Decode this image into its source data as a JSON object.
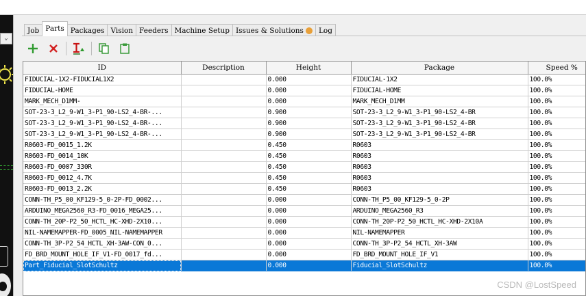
{
  "tabs": [
    {
      "label": "Job"
    },
    {
      "label": "Parts"
    },
    {
      "label": "Packages"
    },
    {
      "label": "Vision"
    },
    {
      "label": "Feeders"
    },
    {
      "label": "Machine Setup"
    },
    {
      "label": "Issues & Solutions"
    },
    {
      "label": "Log"
    }
  ],
  "active_tab": "Parts",
  "toolbar": {
    "icons": [
      "plus-icon",
      "delete-icon",
      "paste-to-height-icon",
      "copy-icon",
      "paste-icon"
    ],
    "colors": {
      "add": "#2e9a2e",
      "delete": "#d22020",
      "copy": "#3a9a3a"
    }
  },
  "table": {
    "columns": [
      "ID",
      "Description",
      "Height",
      "Package",
      "Speed %"
    ],
    "rows": [
      {
        "id": "FIDUCIAL-1X2-FIDUCIAL1X2",
        "description": "",
        "height": "0.000",
        "package": "FIDUCIAL-1X2",
        "speed": "100.0%"
      },
      {
        "id": "FIDUCIAL-HOME",
        "description": "",
        "height": "0.000",
        "package": "FIDUCIAL-HOME",
        "speed": "100.0%"
      },
      {
        "id": "MARK_MECH_D1MM-",
        "description": "",
        "height": "0.000",
        "package": "MARK_MECH_D1MM",
        "speed": "100.0%"
      },
      {
        "id": "SOT-23-3_L2_9-W1_3-P1_90-LS2_4-BR-...",
        "description": "",
        "height": "0.900",
        "package": "SOT-23-3_L2_9-W1_3-P1_90-LS2_4-BR",
        "speed": "100.0%"
      },
      {
        "id": "SOT-23-3_L2_9-W1_3-P1_90-LS2_4-BR-...",
        "description": "",
        "height": "0.900",
        "package": "SOT-23-3_L2_9-W1_3-P1_90-LS2_4-BR",
        "speed": "100.0%"
      },
      {
        "id": "SOT-23-3_L2_9-W1_3-P1_90-LS2_4-BR-...",
        "description": "",
        "height": "0.900",
        "package": "SOT-23-3_L2_9-W1_3-P1_90-LS2_4-BR",
        "speed": "100.0%"
      },
      {
        "id": "R0603-FD_0015_1.2K",
        "description": "",
        "height": "0.450",
        "package": "R0603",
        "speed": "100.0%"
      },
      {
        "id": "R0603-FD_0014_10K",
        "description": "",
        "height": "0.450",
        "package": "R0603",
        "speed": "100.0%"
      },
      {
        "id": "R0603-FD_0007_330R",
        "description": "",
        "height": "0.450",
        "package": "R0603",
        "speed": "100.0%"
      },
      {
        "id": "R0603-FD_0012_4.7K",
        "description": "",
        "height": "0.450",
        "package": "R0603",
        "speed": "100.0%"
      },
      {
        "id": "R0603-FD_0013_2.2K",
        "description": "",
        "height": "0.450",
        "package": "R0603",
        "speed": "100.0%"
      },
      {
        "id": "CONN-TH_P5_00_KF129-5_0-2P-FD_0002...",
        "description": "",
        "height": "0.000",
        "package": "CONN-TH_P5_00_KF129-5_0-2P",
        "speed": "100.0%"
      },
      {
        "id": "ARDUINO_MEGA2560_R3-FD_0016_MEGA25...",
        "description": "",
        "height": "0.000",
        "package": "ARDUINO_MEGA2560_R3",
        "speed": "100.0%"
      },
      {
        "id": "CONN-TH_20P-P2_50_HCTL_HC-XHD-2X10...",
        "description": "",
        "height": "0.000",
        "package": "CONN-TH_20P-P2_50_HCTL_HC-XHD-2X10A",
        "speed": "100.0%"
      },
      {
        "id": "NIL-NAMEMAPPER-FD_0005_NIL-NAMEMAPPER",
        "description": "",
        "height": "0.000",
        "package": "NIL-NAMEMAPPER",
        "speed": "100.0%"
      },
      {
        "id": "CONN-TH_3P-P2_54_HCTL_XH-3AW-CON_0...",
        "description": "",
        "height": "0.000",
        "package": "CONN-TH_3P-P2_54_HCTL_XH-3AW",
        "speed": "100.0%"
      },
      {
        "id": "FD_BRD_MOUNT_HOLE_IF_V1-FD_0017_fd...",
        "description": "",
        "height": "0.000",
        "package": "FD_BRD_MOUNT_HOLE_IF_V1",
        "speed": "100.0%"
      },
      {
        "id": "Part_Fiducial_SlotSchultz",
        "description": "",
        "height": "0.000",
        "package": "Fiducial_SlotSchultz",
        "speed": "100.0%"
      }
    ],
    "selected_row": 17,
    "selection_color": "#0a78d7"
  },
  "watermark": "CSDN @LostSpeed"
}
